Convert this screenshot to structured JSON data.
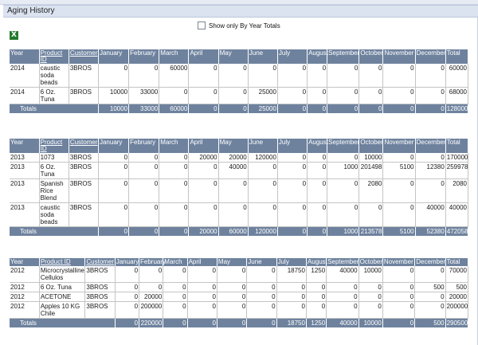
{
  "header": {
    "title": "Aging History"
  },
  "filter": {
    "label": "Show only By Year Totals"
  },
  "export": {
    "icon": "excel-icon"
  },
  "tables": [
    {
      "columns": [
        "Year",
        "Product ID",
        "Customer",
        "January",
        "February",
        "March",
        "April",
        "May",
        "June",
        "July",
        "August",
        "September",
        "October",
        "November",
        "December",
        "Total"
      ],
      "rows": [
        [
          "2014",
          "caustic soda beads",
          "3BROS",
          "0",
          "0",
          "60000",
          "0",
          "0",
          "0",
          "0",
          "0",
          "0",
          "0",
          "0",
          "0",
          "60000"
        ],
        [
          "2014",
          "6 Oz. Tuna",
          "3BROS",
          "10000",
          "33000",
          "0",
          "0",
          "0",
          "25000",
          "0",
          "0",
          "0",
          "0",
          "0",
          "0",
          "68000"
        ]
      ],
      "totals": [
        "Totals",
        "10000",
        "33000",
        "60000",
        "0",
        "0",
        "25000",
        "0",
        "0",
        "0",
        "0",
        "0",
        "0",
        "128000"
      ]
    },
    {
      "columns": [
        "Year",
        "Product ID",
        "Customer",
        "January",
        "February",
        "March",
        "April",
        "May",
        "June",
        "July",
        "August",
        "September",
        "October",
        "November",
        "December",
        "Total"
      ],
      "rows": [
        [
          "2013",
          "1073",
          "3BROS",
          "0",
          "0",
          "0",
          "20000",
          "20000",
          "120000",
          "0",
          "0",
          "0",
          "10000",
          "0",
          "0",
          "170000"
        ],
        [
          "2013",
          "6 Oz. Tuna",
          "3BROS",
          "0",
          "0",
          "0",
          "0",
          "40000",
          "0",
          "0",
          "0",
          "1000",
          "201498",
          "5100",
          "12380",
          "259978"
        ],
        [
          "2013",
          "Spanish Rice Blend",
          "3BROS",
          "0",
          "0",
          "0",
          "0",
          "0",
          "0",
          "0",
          "0",
          "0",
          "2080",
          "0",
          "0",
          "2080"
        ],
        [
          "2013",
          "caustic soda beads",
          "3BROS",
          "0",
          "0",
          "0",
          "0",
          "0",
          "0",
          "0",
          "0",
          "0",
          "0",
          "0",
          "40000",
          "40000"
        ]
      ],
      "totals": [
        "Totals",
        "0",
        "0",
        "0",
        "20000",
        "60000",
        "120000",
        "0",
        "0",
        "1000",
        "213578",
        "5100",
        "52380",
        "472058"
      ]
    },
    {
      "columns": [
        "Year",
        "Product ID",
        "Customer",
        "January",
        "February",
        "March",
        "April",
        "May",
        "June",
        "July",
        "August",
        "September",
        "October",
        "November",
        "December",
        "Total"
      ],
      "rows": [
        [
          "2012",
          "Microcrystalline Cellulos",
          "3BROS",
          "0",
          "0",
          "0",
          "0",
          "0",
          "0",
          "18750",
          "1250",
          "40000",
          "10000",
          "0",
          "0",
          "70000"
        ],
        [
          "2012",
          "6 Oz. Tuna",
          "3BROS",
          "0",
          "0",
          "0",
          "0",
          "0",
          "0",
          "0",
          "0",
          "0",
          "0",
          "0",
          "500",
          "500"
        ],
        [
          "2012",
          "ACETONE",
          "3BROS",
          "0",
          "20000",
          "0",
          "0",
          "0",
          "0",
          "0",
          "0",
          "0",
          "0",
          "0",
          "0",
          "20000"
        ],
        [
          "2012",
          "Apples 10 KG Chile",
          "3BROS",
          "0",
          "200000",
          "0",
          "0",
          "0",
          "0",
          "0",
          "0",
          "0",
          "0",
          "0",
          "0",
          "200000"
        ]
      ],
      "totals": [
        "Totals",
        "0",
        "220000",
        "0",
        "0",
        "0",
        "0",
        "18750",
        "1250",
        "40000",
        "10000",
        "0",
        "500",
        "290500"
      ]
    }
  ]
}
